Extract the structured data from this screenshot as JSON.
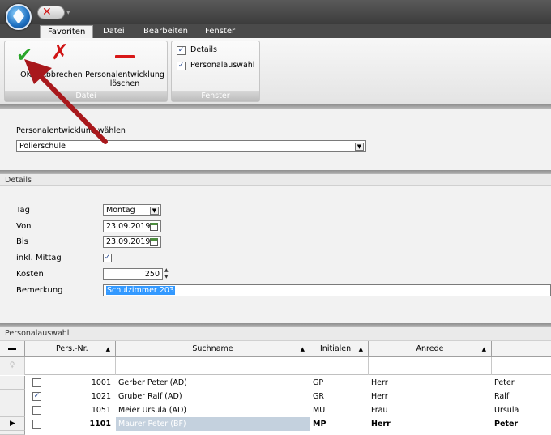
{
  "tabs": [
    "Favoriten",
    "Datei",
    "Bearbeiten",
    "Fenster"
  ],
  "ribbon": {
    "datei_group": {
      "label": "Datei",
      "ok": "OK",
      "abbrechen": "Abbrechen",
      "loeschen_line1": "Personalentwicklung",
      "loeschen_line2": "löschen"
    },
    "fenster_group": {
      "label": "Fenster",
      "details": "Details",
      "personalauswahl": "Personalauswahl"
    }
  },
  "selection": {
    "label": "Personalentwicklung wählen",
    "value": "Polierschule"
  },
  "details": {
    "header": "Details",
    "tag_label": "Tag",
    "tag_value": "Montag",
    "von_label": "Von",
    "von_value": "23.09.2019",
    "bis_label": "Bis",
    "bis_value": "23.09.2019",
    "mittag_label": "inkl. Mittag",
    "kosten_label": "Kosten",
    "kosten_value": "250",
    "bemerkung_label": "Bemerkung",
    "bemerkung_value": "Schulzimmer 203"
  },
  "grid": {
    "header": "Personalauswahl",
    "columns": [
      "Pers.-Nr.",
      "Suchname",
      "Initialen",
      "Anrede"
    ],
    "rows": [
      {
        "nr": "1001",
        "name": "Gerber Peter (AD)",
        "ini": "GP",
        "anrede": "Herr",
        "vorname": "Peter"
      },
      {
        "nr": "1021",
        "name": "Gruber Ralf (AD)",
        "ini": "GR",
        "anrede": "Herr",
        "vorname": "Ralf"
      },
      {
        "nr": "1051",
        "name": "Meier Ursula (AD)",
        "ini": "MU",
        "anrede": "Frau",
        "vorname": "Ursula"
      },
      {
        "nr": "1101",
        "name": "Maurer Peter (BF)",
        "ini": "MP",
        "anrede": "Herr",
        "vorname": "Peter"
      }
    ]
  }
}
